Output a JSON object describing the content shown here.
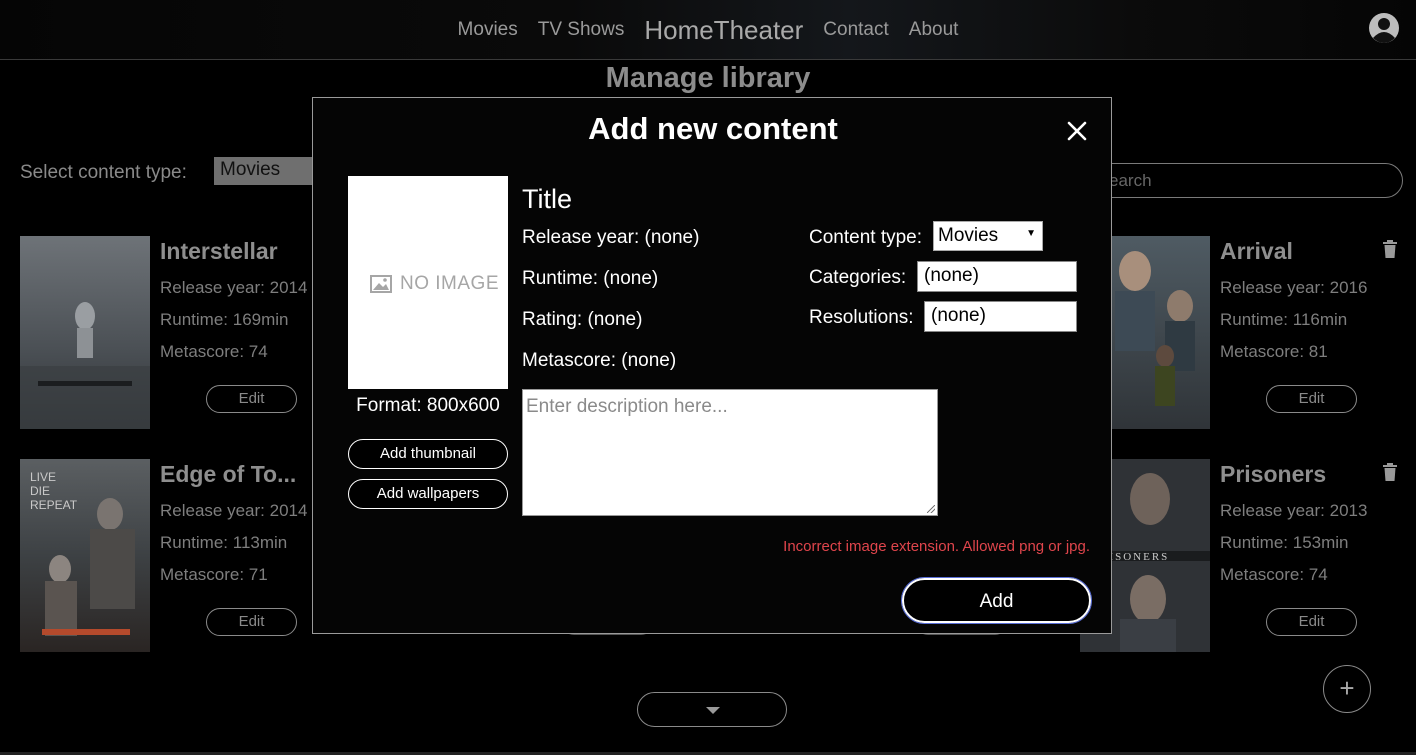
{
  "nav": {
    "links_left": [
      "Movies",
      "TV Shows"
    ],
    "brand": "HomeTheater",
    "links_right": [
      "Contact",
      "About"
    ],
    "user_icon": "user-circle-icon"
  },
  "page": {
    "title": "Manage library",
    "content_type_label": "Select content type:",
    "content_type_value": "Movies",
    "search_placeholder": "Search",
    "search_visible_text": "earch",
    "add_icon": "plus-icon",
    "more_icon": "caret-down-icon"
  },
  "cards": [
    {
      "title": "Interstellar",
      "year": "Release year: 2014",
      "runtime": "Runtime: 169min",
      "metascore": "Metascore: 74",
      "edit": "Edit"
    },
    {
      "title": "Edge of To...",
      "year": "Release year: 2014",
      "runtime": "Runtime: 113min",
      "metascore": "Metascore: 71",
      "edit": "Edit"
    },
    {
      "title": "Arrival",
      "year": "Release year: 2016",
      "runtime": "Runtime: 116min",
      "metascore": "Metascore: 81",
      "edit": "Edit"
    },
    {
      "title": "Prisoners",
      "year": "Release year: 2013",
      "runtime": "Runtime: 153min",
      "metascore": "Metascore: 74",
      "edit": "Edit"
    }
  ],
  "modal": {
    "title": "Add new content",
    "close_icon": "close-icon",
    "thumbnail_placeholder": "NO IMAGE",
    "format": "Format: 800x600",
    "add_thumbnail": "Add thumbnail",
    "add_wallpapers": "Add wallpapers",
    "field_title": "Title",
    "release_year": "Release year:  (none)",
    "runtime": "Runtime:  (none)",
    "rating": "Rating:  (none)",
    "metascore": "Metascore:  (none)",
    "content_type_label": "Content type:",
    "content_type_value": "Movies",
    "categories_label": "Categories:",
    "categories_value": "(none)",
    "resolutions_label": "Resolutions:",
    "resolutions_value": "(none)",
    "description_placeholder": "Enter description here...",
    "error": "Incorrect image extension. Allowed png or jpg.",
    "add_button": "Add",
    "colors": {
      "error": "#e0454c",
      "focus_ring": "#5a6fd8"
    }
  }
}
